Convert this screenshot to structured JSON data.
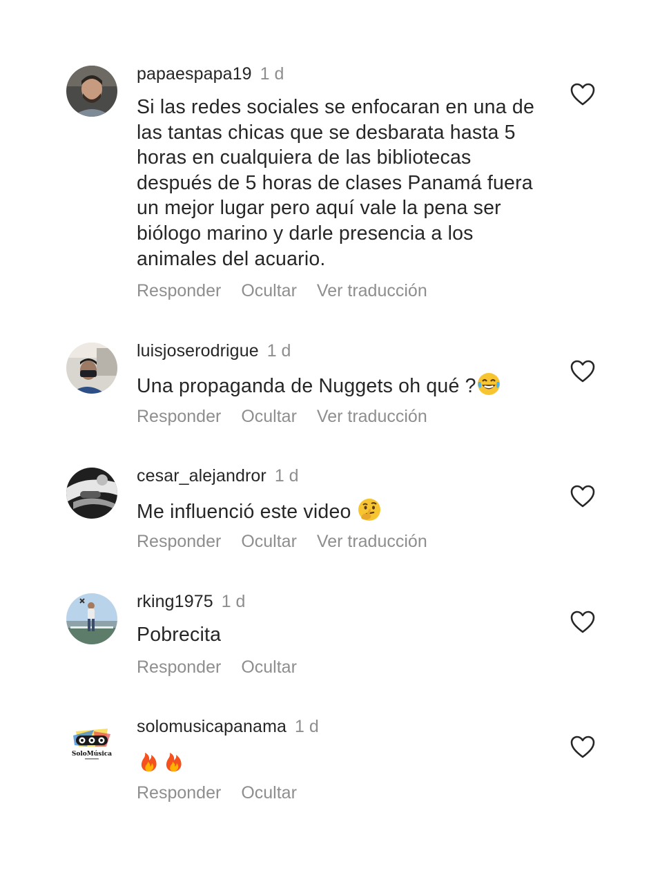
{
  "comments": [
    {
      "username": "papaespapa19",
      "time": "1 d",
      "text": "Si las redes sociales se enfocaran en una de las tantas chicas que se desbarata hasta 5 horas en cualquiera de las bibliotecas después de 5 horas de clases Panamá fuera un mejor lugar pero aquí vale la pena ser biólogo marino y darle presencia a los animales del acuario.",
      "reply": "Responder",
      "hide": "Ocultar",
      "translate": "Ver traducción"
    },
    {
      "username": "luisjoserodrigue",
      "time": "1 d",
      "text": "Una propaganda de Nuggets oh qué ?",
      "emoji": "laughing-tears-emoji",
      "reply": "Responder",
      "hide": "Ocultar",
      "translate": "Ver traducción"
    },
    {
      "username": "cesar_alejandror",
      "time": "1 d",
      "text": "Me influenció este video ",
      "emoji": "thinking-face-emoji",
      "reply": "Responder",
      "hide": "Ocultar",
      "translate": "Ver traducción"
    },
    {
      "username": "rking1975",
      "time": "1 d",
      "text": "Pobrecita",
      "reply": "Responder",
      "hide": "Ocultar"
    },
    {
      "username": "solomusicapanama",
      "time": "1 d",
      "text": "",
      "emoji": "fire-emoji",
      "reply": "Responder",
      "hide": "Ocultar"
    }
  ],
  "avatar_logo_text": "SoloMúsica",
  "colors": {
    "text": "#262626",
    "secondary": "#8e8e8e",
    "background": "#ffffff"
  }
}
